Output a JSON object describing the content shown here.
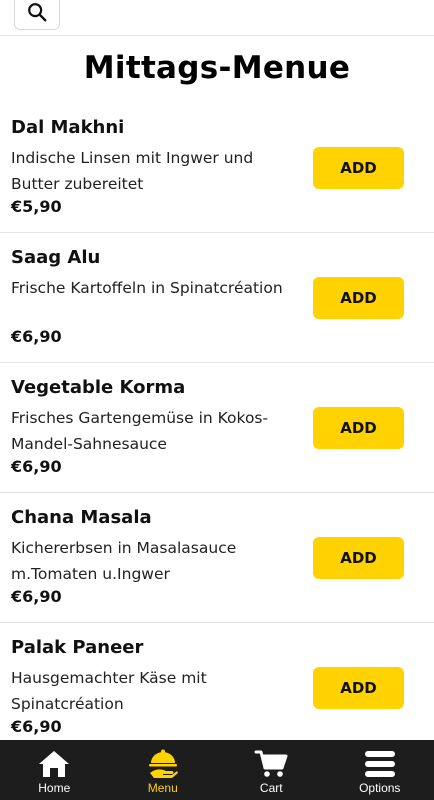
{
  "header": {
    "search_icon": "search-icon"
  },
  "page": {
    "title": "Mittags-Menue"
  },
  "menu_items": [
    {
      "name": "Dal Makhni",
      "description": "Indische Linsen mit Ingwer und Butter zubereitet",
      "price": "€5,90",
      "add_label": "ADD"
    },
    {
      "name": "Saag Alu",
      "description": "Frische Kartoffeln in Spinatcréation",
      "price": "€6,90",
      "add_label": "ADD"
    },
    {
      "name": "Vegetable Korma",
      "description": "Frisches Gartengemüse in Kokos-Mandel-Sahnesauce",
      "price": "€6,90",
      "add_label": "ADD"
    },
    {
      "name": "Chana Masala",
      "description": "Kichererbsen in Masalasauce m.Tomaten u.Ingwer",
      "price": "€6,90",
      "add_label": "ADD"
    },
    {
      "name": "Palak Paneer",
      "description": "Hausgemachter Käse mit Spinatcréation",
      "price": "€6,90",
      "add_label": "ADD"
    }
  ],
  "bottom_nav": {
    "items": [
      {
        "label": "Home",
        "icon": "home-icon",
        "active": false
      },
      {
        "label": "Menu",
        "icon": "menu-serving-icon",
        "active": true
      },
      {
        "label": "Cart",
        "icon": "cart-icon",
        "active": false
      },
      {
        "label": "Options",
        "icon": "options-icon",
        "active": false
      }
    ]
  },
  "colors": {
    "accent": "#ffd200",
    "nav_background": "#1d1d1d",
    "nav_text": "#ffffff"
  }
}
